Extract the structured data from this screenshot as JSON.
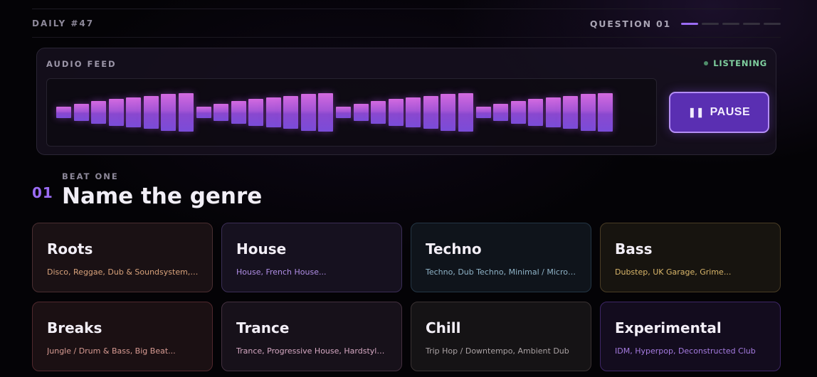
{
  "header": {
    "daily": "DAILY #47",
    "question_label": "QUESTION 01",
    "progress_total": 5,
    "progress_current": 1
  },
  "audio": {
    "label": "AUDIO FEED",
    "status": "LISTENING",
    "status_color": "#7fcf9f",
    "pause_label": "PAUSE",
    "pause_icon": "pause-icon",
    "accent": "#9b6cf4"
  },
  "question": {
    "kicker": "BEAT ONE",
    "number": "01",
    "title": "Name the genre"
  },
  "genres": [
    {
      "name": "Roots",
      "sub": "Disco, Reggae, Dub & Soundsystem, El..."
    },
    {
      "name": "House",
      "sub": "House, French House..."
    },
    {
      "name": "Techno",
      "sub": "Techno, Dub Techno, Minimal / Microh..."
    },
    {
      "name": "Bass",
      "sub": "Dubstep, UK Garage, Grime..."
    },
    {
      "name": "Breaks",
      "sub": "Jungle / Drum & Bass, Big Beat..."
    },
    {
      "name": "Trance",
      "sub": "Trance, Progressive House, Hardstyle..."
    },
    {
      "name": "Chill",
      "sub": "Trip Hop / Downtempo, Ambient Dub"
    },
    {
      "name": "Experimental",
      "sub": "IDM, Hyperpop, Deconstructed Club"
    }
  ]
}
